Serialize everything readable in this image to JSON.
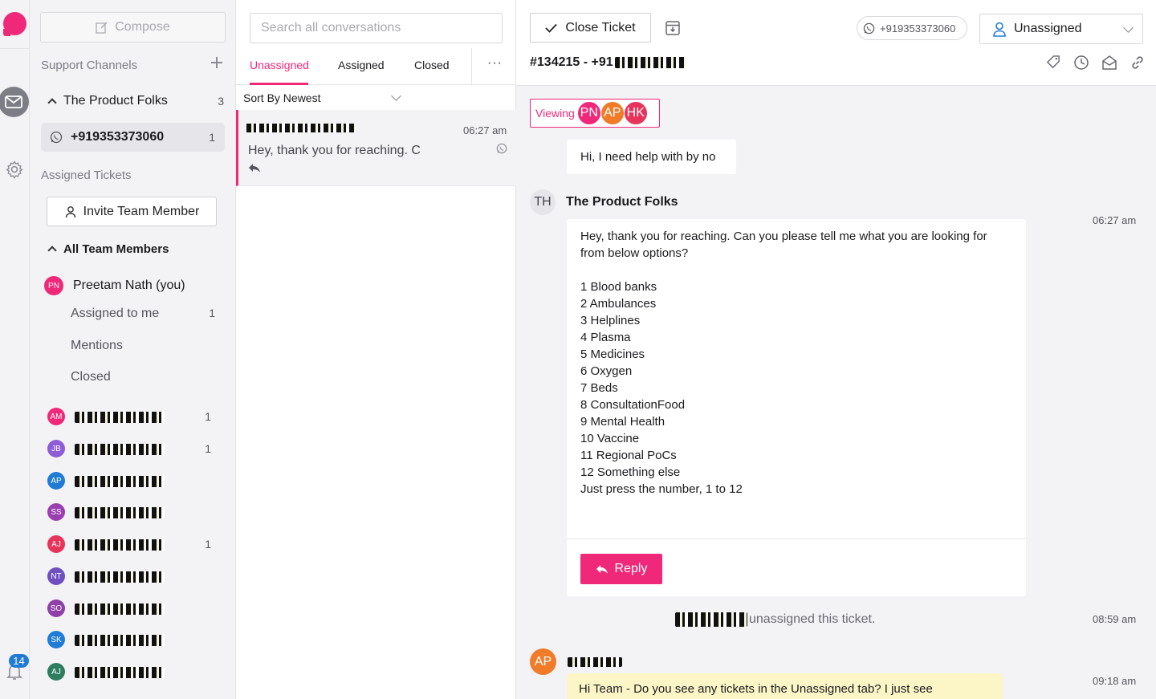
{
  "rail": {
    "notification_count": "14"
  },
  "sidebar": {
    "compose_label": "Compose",
    "support_channels_label": "Support Channels",
    "channel": {
      "name": "The Product Folks",
      "count": "3",
      "phone": "+919353373060",
      "phone_count": "1"
    },
    "assigned_tickets_label": "Assigned Tickets",
    "invite_label": "Invite Team Member",
    "all_team_label": "All Team Members",
    "me": {
      "initials": "PN",
      "name": "Preetam Nath (you)"
    },
    "sub_items": [
      {
        "label": "Assigned to me",
        "count": "1"
      },
      {
        "label": "Mentions",
        "count": ""
      },
      {
        "label": "Closed",
        "count": ""
      }
    ],
    "members": [
      {
        "initials": "AM",
        "color": "#f0287a",
        "count": "1"
      },
      {
        "initials": "JB",
        "color": "#8e5cd6",
        "count": "1"
      },
      {
        "initials": "AP",
        "color": "#1f7bd6",
        "count": ""
      },
      {
        "initials": "SS",
        "color": "#9b3fb0",
        "count": ""
      },
      {
        "initials": "AJ",
        "color": "#e8345a",
        "count": "1"
      },
      {
        "initials": "NT",
        "color": "#6f4fc0",
        "count": ""
      },
      {
        "initials": "SO",
        "color": "#8e3fa8",
        "count": ""
      },
      {
        "initials": "SK",
        "color": "#1f7bd6",
        "count": ""
      },
      {
        "initials": "AJ",
        "color": "#2e7d60",
        "count": ""
      }
    ]
  },
  "list": {
    "search_placeholder": "Search all conversations",
    "tabs": [
      "Unassigned",
      "Assigned",
      "Closed"
    ],
    "more": "···",
    "sort_label": "Sort By Newest",
    "conversation": {
      "time": "06:27 am",
      "preview": "Hey, thank you for reaching. C"
    }
  },
  "main": {
    "close_label": "Close Ticket",
    "phone": "+919353373060",
    "assignee": "Unassigned",
    "ticket_prefix": "#134215 - +91",
    "viewing_label": "Viewing",
    "viewers": [
      {
        "initials": "PN",
        "color": "#f0287a"
      },
      {
        "initials": "AP",
        "color": "#f07c2a"
      },
      {
        "initials": "HK",
        "color": "#e8345a"
      }
    ],
    "incoming_message": "Hi, I need help with by no",
    "sender_initials": "TH",
    "sender_name": "The Product Folks",
    "reply_time": "06:27 am",
    "reply_intro": "Hey, thank you for reaching. Can you please tell me what you are looking for from below options?",
    "options": [
      "1 Blood banks",
      "2 Ambulances",
      "3 Helplines",
      "4 Plasma",
      "5 Medicines",
      "6 Oxygen",
      "7 Beds",
      "8 ConsultationFood",
      "9 Mental Health",
      "10 Vaccine",
      "11 Regional PoCs",
      "12 Something else"
    ],
    "reply_footer": "Just press the number, 1 to 12",
    "reply_button": "Reply",
    "event_text": "unassigned this ticket.",
    "event_time": "08:59 am",
    "note_author_initials": "AP",
    "note_time": "09:18 am",
    "note_text": "Hi Team - Do you see any tickets in the Unassigned tab? I just see"
  }
}
